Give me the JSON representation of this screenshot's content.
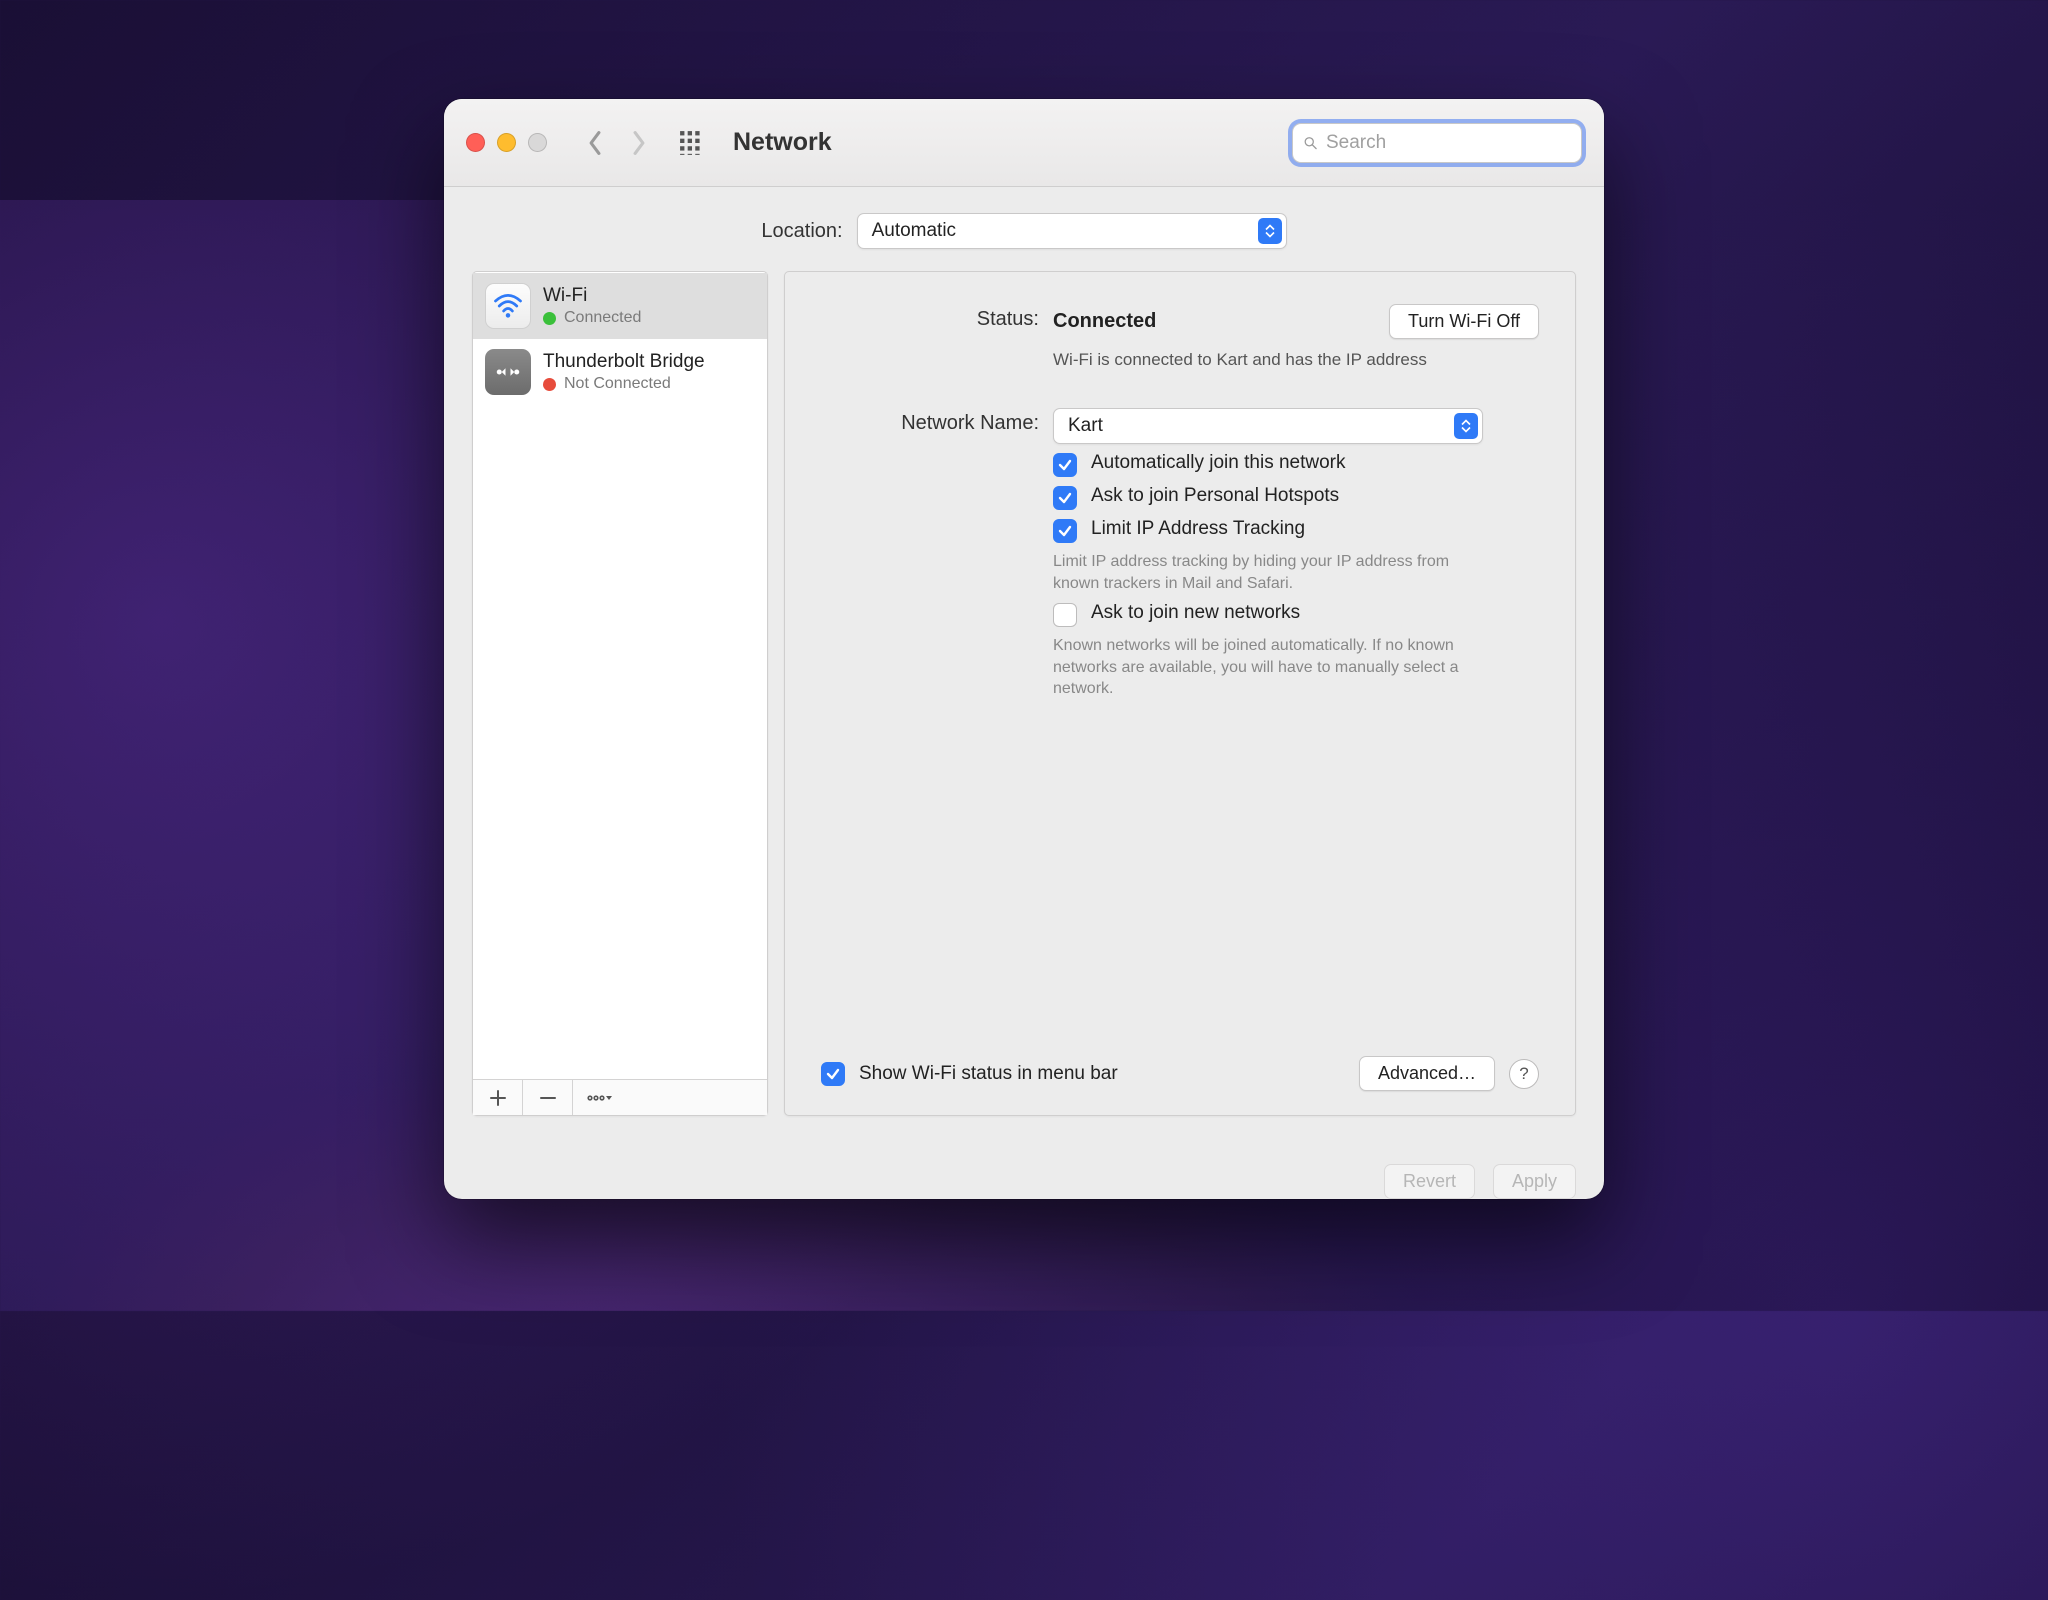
{
  "title": "Network",
  "search_placeholder": "Search",
  "location_label": "Location:",
  "location_value": "Automatic",
  "sidebar": {
    "items": [
      {
        "name": "Wi-Fi",
        "status": "Connected",
        "color": "green",
        "kind": "wifi"
      },
      {
        "name": "Thunderbolt Bridge",
        "status": "Not Connected",
        "color": "red",
        "kind": "tb"
      }
    ]
  },
  "detail": {
    "status_label": "Status:",
    "status_value": "Connected",
    "wifi_toggle": "Turn Wi-Fi Off",
    "status_desc": "Wi-Fi is connected to Kart and has the IP address",
    "network_name_label": "Network Name:",
    "network_name_value": "Kart",
    "opts": {
      "auto_join": "Automatically join this network",
      "ask_hotspot": "Ask to join Personal Hotspots",
      "limit_ip": "Limit IP Address Tracking",
      "limit_ip_help": "Limit IP address tracking by hiding your IP address from known trackers in Mail and Safari.",
      "ask_new": "Ask to join new networks",
      "ask_new_help": "Known networks will be joined automatically. If no known networks are available, you will have to manually select a network."
    },
    "show_menubar": "Show Wi-Fi status in menu bar",
    "advanced": "Advanced…",
    "help": "?"
  },
  "actions": {
    "revert": "Revert",
    "apply": "Apply"
  }
}
